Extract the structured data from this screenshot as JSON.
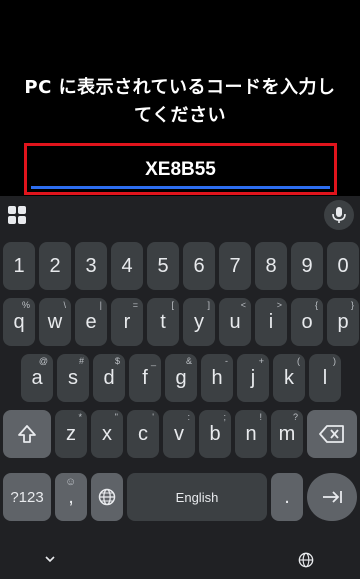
{
  "prompt": {
    "line1": "PC に表示されているコードを入力し",
    "line2": "てください"
  },
  "code_input": {
    "value": "XE8B55"
  },
  "keyboard": {
    "toolbar": {
      "apps_icon": "grid-icon",
      "mic_icon": "mic-icon"
    },
    "numbers": [
      "1",
      "2",
      "3",
      "4",
      "5",
      "6",
      "7",
      "8",
      "9",
      "0"
    ],
    "row1": [
      {
        "key": "q",
        "hint": "%"
      },
      {
        "key": "w",
        "hint": "\\"
      },
      {
        "key": "e",
        "hint": "|"
      },
      {
        "key": "r",
        "hint": "="
      },
      {
        "key": "t",
        "hint": "["
      },
      {
        "key": "y",
        "hint": "]"
      },
      {
        "key": "u",
        "hint": "<"
      },
      {
        "key": "i",
        "hint": ">"
      },
      {
        "key": "o",
        "hint": "{"
      },
      {
        "key": "p",
        "hint": "}"
      }
    ],
    "row2": [
      {
        "key": "a",
        "hint": "@"
      },
      {
        "key": "s",
        "hint": "#"
      },
      {
        "key": "d",
        "hint": "$"
      },
      {
        "key": "f",
        "hint": "_"
      },
      {
        "key": "g",
        "hint": "&"
      },
      {
        "key": "h",
        "hint": "-"
      },
      {
        "key": "j",
        "hint": "+"
      },
      {
        "key": "k",
        "hint": "("
      },
      {
        "key": "l",
        "hint": ")"
      }
    ],
    "row3": [
      {
        "key": "z",
        "hint": "*"
      },
      {
        "key": "x",
        "hint": "\""
      },
      {
        "key": "c",
        "hint": "'"
      },
      {
        "key": "v",
        "hint": ":"
      },
      {
        "key": "b",
        "hint": ";"
      },
      {
        "key": "n",
        "hint": "!"
      },
      {
        "key": "m",
        "hint": "?"
      }
    ],
    "symbols_label": "?123",
    "comma": ",",
    "space_label": "English",
    "period": "."
  },
  "colors": {
    "highlight_border": "#e0141c",
    "underline": "#2d6ef0",
    "key_bg": "#3c4043",
    "special_key_bg": "#5f6368"
  }
}
